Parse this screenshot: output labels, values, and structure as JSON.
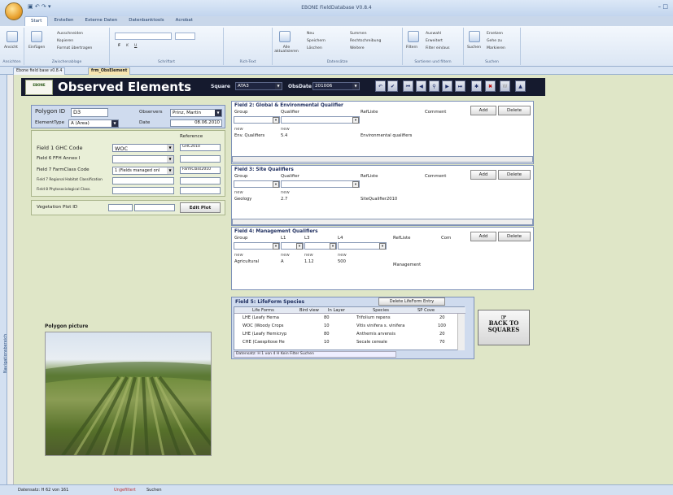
{
  "window": {
    "title": "EBONE FieldDatabase V0.8.4"
  },
  "ribbon": {
    "tabs": [
      "Start",
      "Erstellen",
      "Externe Daten",
      "Datenbanktools",
      "Acrobat"
    ],
    "groups": [
      {
        "name": "Ansichten",
        "items": [
          "Ansicht"
        ]
      },
      {
        "name": "Zwischenablage",
        "items": [
          "Einfügen",
          "Ausschneiden",
          "Kopieren",
          "Format übertragen"
        ]
      },
      {
        "name": "Schriftart",
        "items": [
          "F",
          "K",
          "U"
        ]
      },
      {
        "name": "Rich-Text",
        "items": []
      },
      {
        "name": "Datensätze",
        "items": [
          "Alle aktualisieren",
          "Neu",
          "Speichern",
          "Löschen",
          "Summen",
          "Rechtschreibung",
          "Weitere"
        ]
      },
      {
        "name": "Sortieren und filtern",
        "items": [
          "Filtern",
          "Auswahl",
          "Erweitert",
          "Filter ein/aus"
        ]
      },
      {
        "name": "Suchen",
        "items": [
          "Suchen",
          "Ersetzen",
          "Gehe zu",
          "Markieren"
        ]
      }
    ]
  },
  "doc_tabs": [
    "Ebone field base v0.8.4",
    "frm_ObsElement"
  ],
  "nav_pane_label": "Navigationsbereich",
  "header": {
    "logo": "EBONE",
    "title": "Observed Elements",
    "square_label": "Square",
    "square_value": "ATA3",
    "obsdate_label": "ObsDate",
    "obsdate_value": "201006"
  },
  "polygon": {
    "id_label": "Polygon ID",
    "id_value": "D3",
    "observers_label": "Observers",
    "observers_value": "Prinz, Martin",
    "elementtype_label": "ElementType",
    "elementtype_value": "A (Area)",
    "date_label": "Date",
    "date_value": "08.06.2010"
  },
  "fields": {
    "reference_header": "Reference",
    "f1_label": "Field 1 GHC Code",
    "f1_value": "WOC",
    "f1_ref": "GHC2010",
    "f6_label": "Field 6 FFH Annex I",
    "f7_label": "Field 7 FarmClass Code",
    "f7_value": "1 (Fields managed onl",
    "f7_ref": "FarmClass2010",
    "f7r_label": "Field 7 Regional Habitat Classification",
    "f8_label": "Field 8 Phytosociological Class."
  },
  "vegplot": {
    "label": "Vegetation Plot ID",
    "edit": "Edit Plot"
  },
  "field2": {
    "title": "Field 2: Global & Environmental Qualifier",
    "cols": [
      "Group",
      "Qualifier",
      "RefListe",
      "Comment"
    ],
    "row": [
      "new",
      "new",
      "",
      ""
    ],
    "row2": [
      "Env. Qualifiers",
      "5.4",
      "Environmental qualifiers",
      ""
    ],
    "add": "Add",
    "delete": "Delete"
  },
  "field3": {
    "title": "Field 3: Site Qualifiers",
    "cols": [
      "Group",
      "Qualifier",
      "RefListe",
      "Comment"
    ],
    "row": [
      "new",
      "new"
    ],
    "row2": [
      "Geology",
      "2.7",
      "SiteQualifier2010"
    ],
    "add": "Add",
    "delete": "Delete"
  },
  "field4": {
    "title": "Field 4: Management Qualifiers",
    "cols": [
      "Group",
      "L1",
      "L3",
      "L4",
      "RefListe",
      "Com"
    ],
    "row": [
      "new",
      "new",
      "new",
      "new"
    ],
    "row2": [
      "Agricultural",
      "A",
      "1.12",
      "500",
      "Management"
    ],
    "add": "Add",
    "delete": "Delete"
  },
  "field5": {
    "title": "Field 5: LifeForm Species",
    "delete_btn": "Delete LifeForm Entry",
    "cols": [
      "Life Forms",
      "Bird view",
      "In Layer",
      "Species",
      "SP Cove"
    ],
    "rows": [
      [
        "LHE (Leafy Herna",
        "",
        "80",
        "Trifolium repens",
        "20"
      ],
      [
        "WOC (Woody Crops",
        "",
        "10",
        "Vitis vinifera s. vinifera",
        "100"
      ],
      [
        "LHE (Leafy Hemicryp",
        "",
        "80",
        "Anthemis arvensis",
        "20"
      ],
      [
        "CHE (Caespitose He",
        "",
        "10",
        "Secale cereale",
        "70"
      ]
    ],
    "nav": "Datensatz: H  1 von 4  H  Kein Filter  Suchen"
  },
  "back_button": "BACK TO SQUARES",
  "picture_label": "Polygon picture",
  "status": {
    "record_nav": "Datensatz: H  62 von 161",
    "filter": "Ungefiltert",
    "search": "Suchen"
  },
  "colors": {
    "header_bg": "#151a2e",
    "form_bg": "#dfe6c7",
    "panel_bg": "#cfdbee"
  }
}
